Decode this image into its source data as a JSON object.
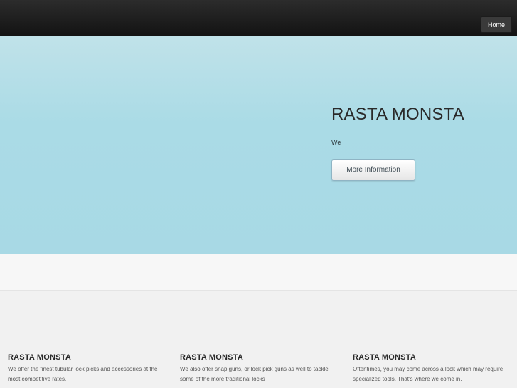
{
  "nav": {
    "home_label": "Home"
  },
  "hero": {
    "title": "RASTA MONSTA",
    "text": "We",
    "button_label": "More Information"
  },
  "features": [
    {
      "title": "RASTA MONSTA",
      "text": "We offer the finest tubular lock picks and accessories at the most competitive rates."
    },
    {
      "title": "RASTA MONSTA",
      "text": "We also offer snap guns, or lock pick guns as well to tackle some of the more traditional locks"
    },
    {
      "title": "RASTA MONSTA",
      "text": "Oftentimes, you may come across a lock which may require specialized tools. That's where we come in."
    }
  ]
}
